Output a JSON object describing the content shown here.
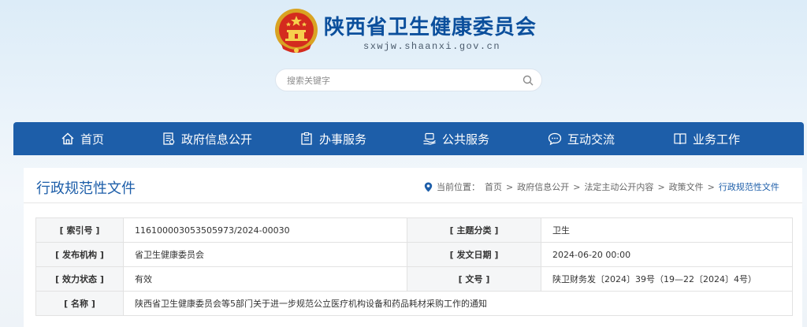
{
  "site": {
    "title": "陕西省卫生健康委员会",
    "domain": "sxwjw.shaanxi.gov.cn"
  },
  "search": {
    "placeholder": "搜索关键字"
  },
  "nav": {
    "items": [
      {
        "label": "首页",
        "icon": "home-icon"
      },
      {
        "label": "政府信息公开",
        "icon": "document-list-icon"
      },
      {
        "label": "办事服务",
        "icon": "clipboard-icon"
      },
      {
        "label": "公共服务",
        "icon": "hand-service-icon"
      },
      {
        "label": "互动交流",
        "icon": "chat-bubble-icon"
      },
      {
        "label": "业务工作",
        "icon": "book-icon"
      }
    ]
  },
  "panel": {
    "title": "行政规范性文件",
    "breadcrumb_prefix": "当前位置：",
    "breadcrumb": [
      "首页",
      "政府信息公开",
      "法定主动公开内容",
      "政策文件",
      "行政规范性文件"
    ]
  },
  "info": {
    "index_label": "[ 索引号 ]",
    "index_value": "116100003053505973/2024-00030",
    "topic_label": "[ 主题分类 ]",
    "topic_value": "卫生",
    "issuer_label": "[ 发布机构 ]",
    "issuer_value": "省卫生健康委员会",
    "date_label": "[ 发文日期 ]",
    "date_value": "2024-06-20 00:00",
    "status_label": "[ 效力状态 ]",
    "status_value": "有效",
    "docno_label": "[ 文号 ]",
    "docno_value": "陕卫财务发〔2024〕39号（19—22〔2024〕4号）",
    "name_label": "[ 名称 ]",
    "name_value": "陕西省卫生健康委员会等5部门关于进一步规范公立医疗机构设备和药品耗材采购工作的通知"
  },
  "colors": {
    "nav_bg": "#1d5ea9",
    "title_blue": "#0b4f9c",
    "status_green": "#1e9a2a"
  }
}
